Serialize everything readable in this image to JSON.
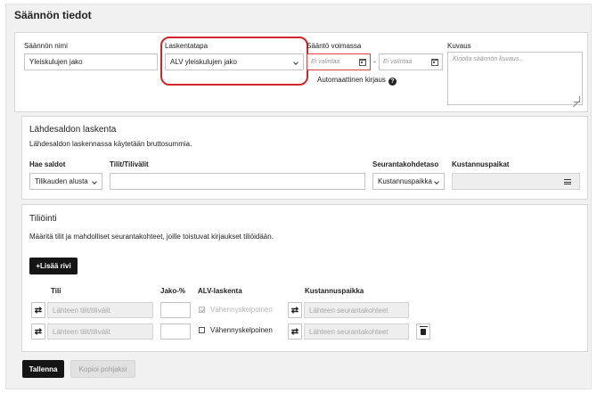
{
  "page_title": "Säännön tiedot",
  "rule": {
    "name_label": "Säännön nimi",
    "name_value": "Yleiskulujen jako",
    "calc_label": "Laskentatapa",
    "calc_value": "ALV yleiskulujen jako",
    "valid_label": "Sääntö voimassa",
    "date_from_placeholder": "Ei valintaa",
    "date_to_placeholder": "Ei valintaa",
    "date_separator": "-",
    "auto_label": "Automaattinen kirjaus",
    "help_glyph": "?",
    "desc_label": "Kuvaus",
    "desc_placeholder": "Kirjoita säännön kuvaus..."
  },
  "source": {
    "title": "Lähdesaldon laskenta",
    "description": "Lähdesaldon laskennassa käytetään bruttosummia.",
    "fetch_label": "Hae saldot",
    "fetch_value": "Tilikauden alusta",
    "accounts_label": "Tilit/Tilivälit",
    "accounts_value": "",
    "tracking_label": "Seurantakohdetaso",
    "tracking_value": "Kustannuspaikka",
    "costcenters_label": "Kustannuspaikat"
  },
  "posting": {
    "title": "Tiliöinti",
    "description": "Määritä tilit ja mahdolliset seurantakohteet, joille toistuvat kirjaukset tiliöidään.",
    "add_row_label": "+Lisää rivi",
    "columns": {
      "account": "Tili",
      "share": "Jako-%",
      "vat": "ALV-laskenta",
      "costcenter": "Kustannuspaikka"
    },
    "rows": [
      {
        "account_placeholder": "Lähteen tilit/tilivälit",
        "share": "",
        "vat_label": "Vähennyskelpoinen",
        "vat_checked": true,
        "vat_disabled": true,
        "costcenter_placeholder": "Lähteen seurantakohteet",
        "deletable": false
      },
      {
        "account_placeholder": "Lähteen tilit/tilivälit",
        "share": "",
        "vat_label": "Vähennyskelpoinen",
        "vat_checked": false,
        "vat_disabled": false,
        "costcenter_placeholder": "Lähteen seurantakohteet",
        "deletable": true
      }
    ],
    "swap_glyph": "⇄"
  },
  "actions": {
    "save_label": "Tallenna",
    "copy_label": "Kopioi pohjaksi"
  },
  "colors": {
    "highlight": "#d0262b",
    "error_border": "#e04040",
    "primary_button": "#151515"
  }
}
